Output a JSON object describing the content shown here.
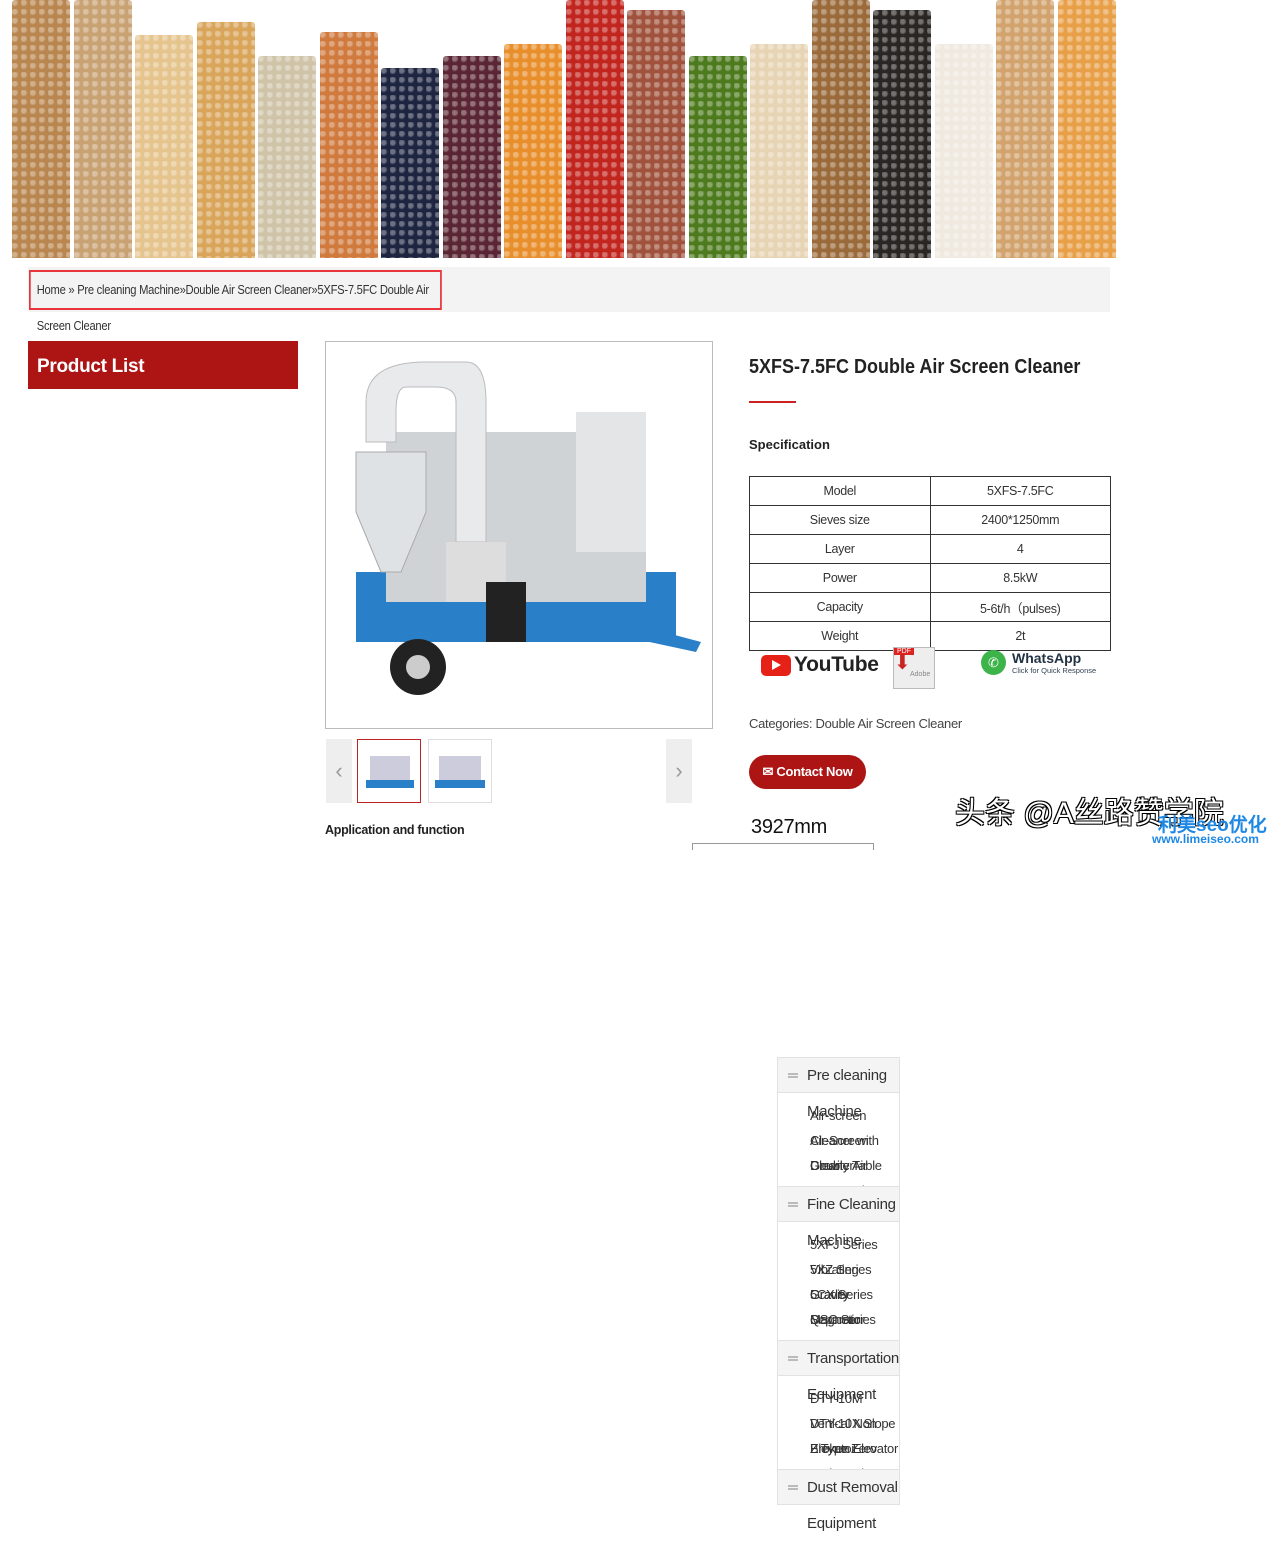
{
  "banner": {
    "colors": [
      "#b9864f",
      "#c9a273",
      "#e6c48e",
      "#d9a55a",
      "#cfc3a8",
      "#d07a3e",
      "#1e2540",
      "#5b2634",
      "#e88f2c",
      "#c2241e",
      "#a0523c",
      "#4d7a1d",
      "#e7d4b4",
      "#9a6a3a",
      "#2a2623",
      "#efe9df",
      "#d2a36d",
      "#e8a048"
    ],
    "tops": [
      0,
      0,
      35,
      22,
      56,
      32,
      68,
      56,
      44,
      0,
      10,
      56,
      44,
      0,
      10,
      44,
      0,
      0
    ]
  },
  "breadcrumb": {
    "home": "Home",
    "sep": " » ",
    "items": [
      "Pre cleaning Machine",
      "Double Air Screen Cleaner",
      "5XFS-7.5FC Double Air Screen Cleaner"
    ],
    "sep2": "»"
  },
  "sidebar": {
    "title": "Product List",
    "categories": [
      {
        "label": "Pre cleaning Machine",
        "items": [
          "Air-screen Cleaner with Gravity Table",
          "Air-Screen Cleaner",
          "Double Air Screen Cleaner"
        ]
      },
      {
        "label": "Fine Cleaning Machine",
        "items": [
          "5XFJ Series Vibrating Grader",
          "5XZ Series Gravity Separator",
          "5CX Series Magnetic Separator",
          "QSC Series Destoner"
        ]
      },
      {
        "label": "Transportation Equipment",
        "items": [
          "DTY-10M Vertical Non Broken Elevator",
          "DTY-10X Slope Elevator",
          "Z Type Zero Broken Elevator"
        ]
      },
      {
        "label": "Dust Removal Equipment",
        "items": []
      }
    ]
  },
  "gallery": {
    "prev": "‹",
    "next": "›"
  },
  "product": {
    "title": "5XFS-7.5FC Double Air Screen Cleaner",
    "spec_label": "Specification",
    "specs": [
      [
        "Model",
        "5XFS-7.5FC"
      ],
      [
        "Sieves size",
        "2400*1250mm"
      ],
      [
        "Layer",
        "4"
      ],
      [
        "Power",
        "8.5kW"
      ],
      [
        "Capacity",
        "5-6t/h（pulses)"
      ],
      [
        "Weight",
        "2t"
      ]
    ],
    "youtube": "YouTube",
    "pdf": "PDF",
    "adobe": "Adobe",
    "whatsapp": "WhatsApp",
    "whatsapp_sub": "Click for Quick Response",
    "categories_label": "Categories: ",
    "category": "Double Air Screen Cleaner",
    "contact": "Contact Now",
    "application": "Application and function",
    "dimension": "3927mm"
  },
  "watermark": {
    "line1": "头条 @A丝路赞学院",
    "brand": "利美seo优化",
    "url": "www.limeiseo.com"
  },
  "colors": {
    "accent": "#ad1414",
    "highlight": "#e8343a"
  }
}
